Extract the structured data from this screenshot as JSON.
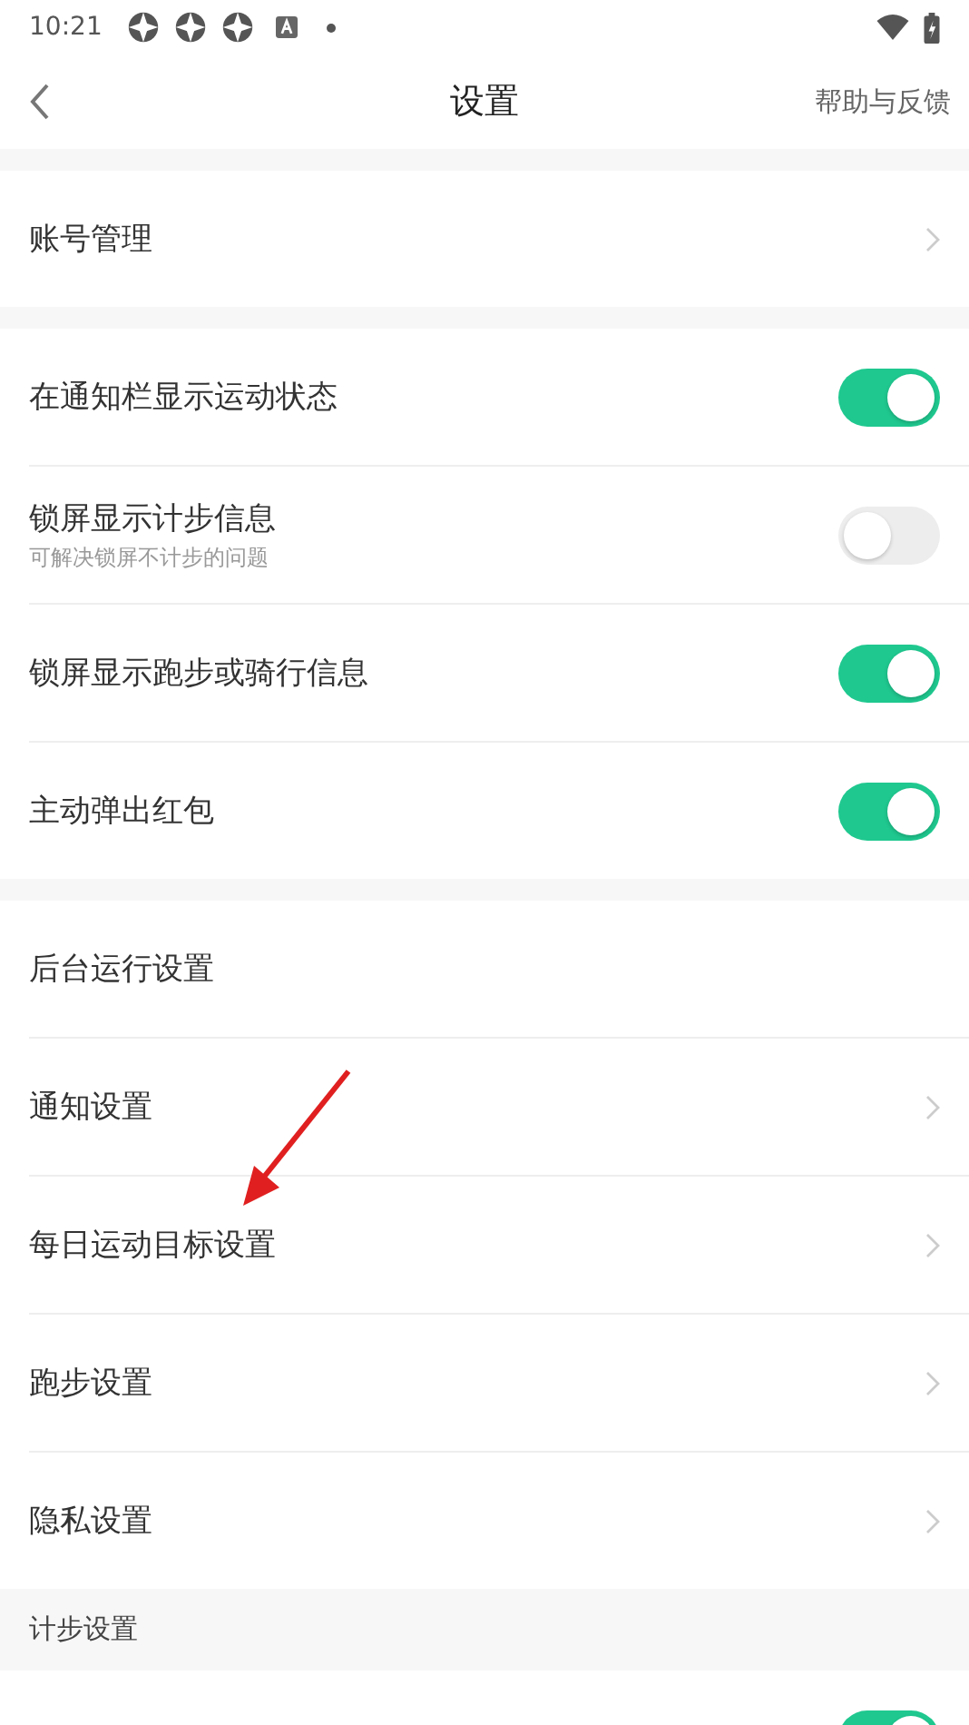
{
  "status_bar": {
    "time": "10:21"
  },
  "header": {
    "title": "设置",
    "action": "帮助与反馈"
  },
  "sections": [
    {
      "kind": "group",
      "items": [
        {
          "kind": "link",
          "label": "账号管理",
          "chevron": true
        }
      ]
    },
    {
      "kind": "group",
      "items": [
        {
          "kind": "toggle",
          "label": "在通知栏显示运动状态",
          "on": true
        },
        {
          "kind": "toggle",
          "label": "锁屏显示计步信息",
          "subtitle": "可解决锁屏不计步的问题",
          "on": false
        },
        {
          "kind": "toggle",
          "label": "锁屏显示跑步或骑行信息",
          "on": true
        },
        {
          "kind": "toggle",
          "label": "主动弹出红包",
          "on": true
        }
      ]
    },
    {
      "kind": "group",
      "items": [
        {
          "kind": "link",
          "label": "后台运行设置",
          "chevron": false
        },
        {
          "kind": "link",
          "label": "通知设置",
          "chevron": true
        },
        {
          "kind": "link",
          "label": "每日运动目标设置",
          "chevron": true
        },
        {
          "kind": "link",
          "label": "跑步设置",
          "chevron": true
        },
        {
          "kind": "link",
          "label": "隐私设置",
          "chevron": true
        }
      ]
    },
    {
      "kind": "titled",
      "title": "计步设置",
      "items": [
        {
          "kind": "toggle",
          "on": true
        }
      ]
    }
  ]
}
